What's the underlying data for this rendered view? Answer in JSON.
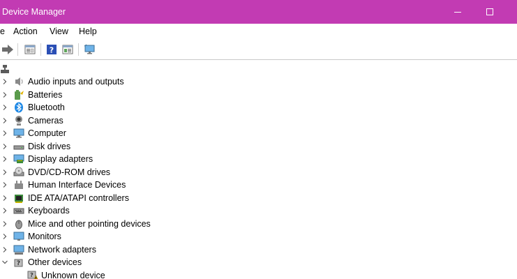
{
  "window": {
    "title": "Device Manager"
  },
  "menu": {
    "file_partial": "e",
    "action": "Action",
    "view": "View",
    "help": "Help"
  },
  "toolbar": {
    "icons": [
      "forward-arrow-icon",
      "properties-icon",
      "help-icon",
      "update-driver-icon",
      "scan-monitor-icon"
    ]
  },
  "tree": {
    "categories": [
      {
        "label": "Audio inputs and outputs",
        "icon": "speaker-icon"
      },
      {
        "label": "Batteries",
        "icon": "battery-icon"
      },
      {
        "label": "Bluetooth",
        "icon": "bluetooth-icon"
      },
      {
        "label": "Cameras",
        "icon": "camera-icon"
      },
      {
        "label": "Computer",
        "icon": "computer-icon"
      },
      {
        "label": "Disk drives",
        "icon": "disk-drive-icon"
      },
      {
        "label": "Display adapters",
        "icon": "display-adapter-icon"
      },
      {
        "label": "DVD/CD-ROM drives",
        "icon": "dvd-drive-icon"
      },
      {
        "label": "Human Interface Devices",
        "icon": "hid-icon"
      },
      {
        "label": "IDE ATA/ATAPI controllers",
        "icon": "ide-controller-icon"
      },
      {
        "label": "Keyboards",
        "icon": "keyboard-icon"
      },
      {
        "label": "Mice and other pointing devices",
        "icon": "mouse-icon"
      },
      {
        "label": "Monitors",
        "icon": "monitor-icon"
      },
      {
        "label": "Network adapters",
        "icon": "network-adapter-icon"
      },
      {
        "label": "Other devices",
        "icon": "other-devices-icon",
        "expanded": true
      }
    ],
    "other_devices_children": [
      {
        "label": "Unknown device",
        "icon": "unknown-device-warning-icon"
      }
    ]
  },
  "colors": {
    "titlebar": "#c23bb3",
    "accent_blue": "#1e88e5"
  }
}
